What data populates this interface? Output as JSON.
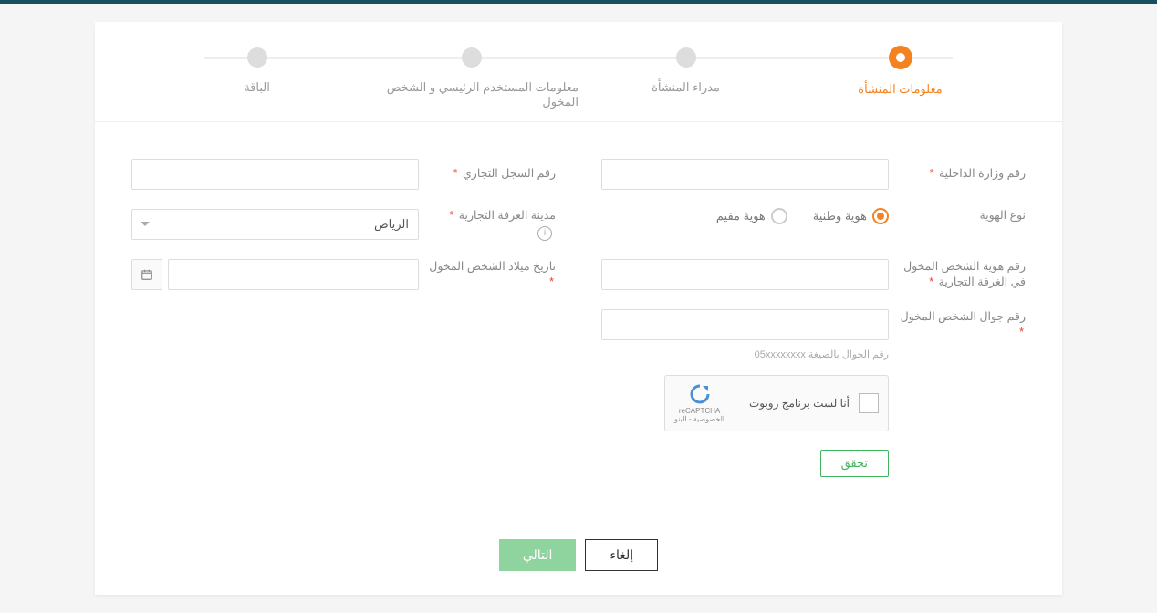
{
  "steps": {
    "s1": "معلومات المنشأة",
    "s2": "مدراء المنشأة",
    "s3": "معلومات المستخدم الرئيسي و الشخص المخول",
    "s4": "الباقة"
  },
  "labels": {
    "ministry_num": "رقم وزارة الداخلية",
    "cr_num": "رقم السجل التجاري",
    "id_type": "نوع الهوية",
    "chamber_city": "مدينة الغرفة التجارية",
    "auth_id": "رقم هوية الشخص المخول في الغرفة التجارية",
    "auth_dob": "تاريخ ميلاد الشخص المخول",
    "auth_mobile": "رقم جوال الشخص المخول"
  },
  "radios": {
    "national": "هوية وطنية",
    "resident": "هوية مقيم"
  },
  "select": {
    "riyadh": "الرياض"
  },
  "hints": {
    "mobile": "رقم الجوال بالصيغة 05xxxxxxxx"
  },
  "captcha": {
    "text": "أنا لست برنامج روبوت",
    "brand": "reCAPTCHA",
    "sub": "الخصوصية - البنو"
  },
  "buttons": {
    "verify": "تحقق",
    "next": "التالي",
    "cancel": "إلغاء"
  }
}
